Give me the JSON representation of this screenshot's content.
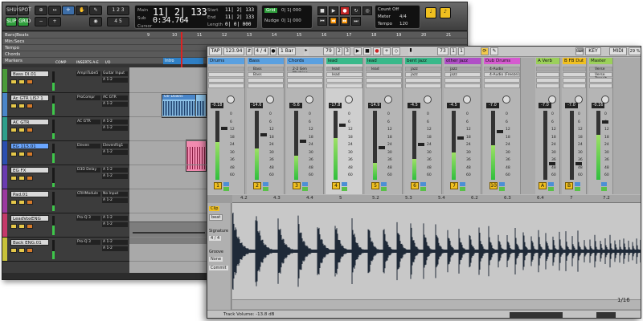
{
  "protools": {
    "toolbar": {
      "mode_buttons": [
        "SHUFFLE",
        "SPOT",
        "SLIP",
        "GRID"
      ],
      "main_label": "Main",
      "sub_label": "Sub",
      "main_counter": "11| 2| 133",
      "sub_counter": "0:34.764",
      "cursor_label": "Cursor",
      "start_label": "Start",
      "end_label": "End",
      "length_label": "Length",
      "start_val": "11| 2| 133",
      "end_val": "11| 2| 133",
      "length_val": "0| 0| 000",
      "nudge_label": "Nudge",
      "grid_label": "Grid",
      "grid_val": "0| 1| 000",
      "nudge_val": "0| 1| 000",
      "count_off": "Count Off",
      "meter_label": "Meter",
      "meter_val": "4/4",
      "tempo_label": "Tempo",
      "tempo_val": "120"
    },
    "rulers": [
      "Bars|Beats",
      "Min:Secs",
      "Tempo",
      "Chords",
      "Markers"
    ],
    "edit_headers": {
      "comp": "COMP",
      "inserts": "INSERTS A-E",
      "io": "I/O"
    },
    "tracks": [
      {
        "name": "Bass DI.01",
        "color": "#4a9b3a",
        "plugin": "AmpliTube5",
        "io": "Guitar Input",
        "meter": 0.4
      },
      {
        "name": "Ac GTR LIS? 1",
        "color": "#4a86c9",
        "plugin": "ProCompr",
        "io": "AC GTR",
        "meter": 0.6
      },
      {
        "name": "AC GTR",
        "color": "#2e9f8c",
        "plugin": "AC GTR",
        "io": "A 1-2",
        "meter": 0.3
      },
      {
        "name": "EG 115.01",
        "color": "#2b4fb0",
        "plugin": "Eleven",
        "io": "ElevenRig1",
        "meter": 0.5
      },
      {
        "name": "EG FX",
        "color": "#6a3bb0",
        "plugin": "D3D Delay",
        "io": "A 1-2",
        "meter": 0.2
      },
      {
        "name": "Pad.01",
        "color": "#9b3aa0",
        "plugin": "CRHModule",
        "io": "No Input",
        "meter": 0.3
      },
      {
        "name": "LeadVoxENG",
        "color": "#c53a6a",
        "plugin": "Pro-Q 3",
        "io": "A 1-2",
        "meter": 0.5
      },
      {
        "name": "Back ENG.01",
        "color": "#c8c23a",
        "plugin": "Pro-Q 3",
        "io": "A 1-2",
        "meter": 0.4
      }
    ],
    "clips": {
      "gtr": "Gtr Downs",
      "intro": "Intro"
    },
    "ruler_marks": [
      "9",
      "10",
      "11",
      "12",
      "13",
      "14",
      "15",
      "16",
      "17",
      "18",
      "19",
      "20",
      "21"
    ]
  },
  "ableton": {
    "toolbar": {
      "tap": "TAP",
      "tempo": "123.94",
      "sig": "4 / 4",
      "quant": "1 Bar",
      "pos1": "79",
      "pos2": "2",
      "pos3": "3",
      "pos4": "73",
      "pos5": "1",
      "pos6": "1",
      "key": "KEY",
      "midi": "MIDI",
      "cpu": "29 %"
    },
    "channels": [
      {
        "name": "Drums",
        "color": "#5aa0e0",
        "slots": [
          "",
          ""
        ],
        "vol": "-0.18",
        "num": "1",
        "meter": 0.55
      },
      {
        "name": "Bass",
        "color": "#5aa0e0",
        "slots": [
          "Bass",
          "Bass"
        ],
        "vol": "-14.6",
        "num": "2",
        "meter": 0.45
      },
      {
        "name": "Chords",
        "color": "#5aa0e0",
        "slots": [
          "2-2 Gen Machine",
          ""
        ],
        "vol": "-5.6",
        "num": "3",
        "meter": 0.35
      },
      {
        "name": "lead",
        "color": "#39b98a",
        "slots": [
          "lead",
          "lead"
        ],
        "vol": "-17.8",
        "num": "4",
        "meter": 0.6
      },
      {
        "name": "lead",
        "color": "#39b98a",
        "slots": [
          "lead",
          ""
        ],
        "vol": "-14.9",
        "num": "5",
        "meter": 0.25
      },
      {
        "name": "bent jazz",
        "color": "#39b98a",
        "slots": [
          "jazz",
          "jazz"
        ],
        "vol": "-4.5",
        "num": "6",
        "meter": 0.3
      },
      {
        "name": "other jazz",
        "color": "#b04fc7",
        "slots": [
          "jazz",
          "jazz"
        ],
        "vol": "-4.5",
        "num": "7",
        "meter": 0.4
      },
      {
        "name": "Dub Drums",
        "color": "#d65ad0",
        "slots": [
          "4-Audio",
          "4-Audio (Freeze)"
        ],
        "vol": "-7.0",
        "num": "10",
        "meter": 0.5
      },
      {
        "name": "A Verb",
        "color": "#9bd05a",
        "slots": [
          "",
          ""
        ],
        "vol": "-7.0",
        "num": "A",
        "meter": 0.0
      },
      {
        "name": "B FB Dut",
        "color": "#f0c020",
        "slots": [
          "",
          ""
        ],
        "vol": "-7.0",
        "num": "B",
        "meter": 0.0
      },
      {
        "name": "Master",
        "color": "#9bd05a",
        "slots": [
          "Verse",
          "Verse Transit"
        ],
        "vol": "-0.16",
        "num": "",
        "meter": 0.65
      }
    ],
    "scale_marks": [
      "0",
      "6",
      "12",
      "18",
      "24",
      "30",
      "36",
      "48",
      "60"
    ],
    "clip": {
      "clip_label": "Clip",
      "clip_name": "beat",
      "signature_label": "Signature",
      "sig": "4 / 4",
      "groove_label": "Groove",
      "groove": "None",
      "commit": "Commit"
    },
    "clip_ruler": [
      "4.2",
      "4.3",
      "4.4",
      "5",
      "5.2",
      "5.3",
      "5.4",
      "6.2",
      "6.3",
      "6.4",
      "7",
      "7.2"
    ],
    "status_text": "Track Volume: -13.8 dB",
    "page": "1/16"
  }
}
